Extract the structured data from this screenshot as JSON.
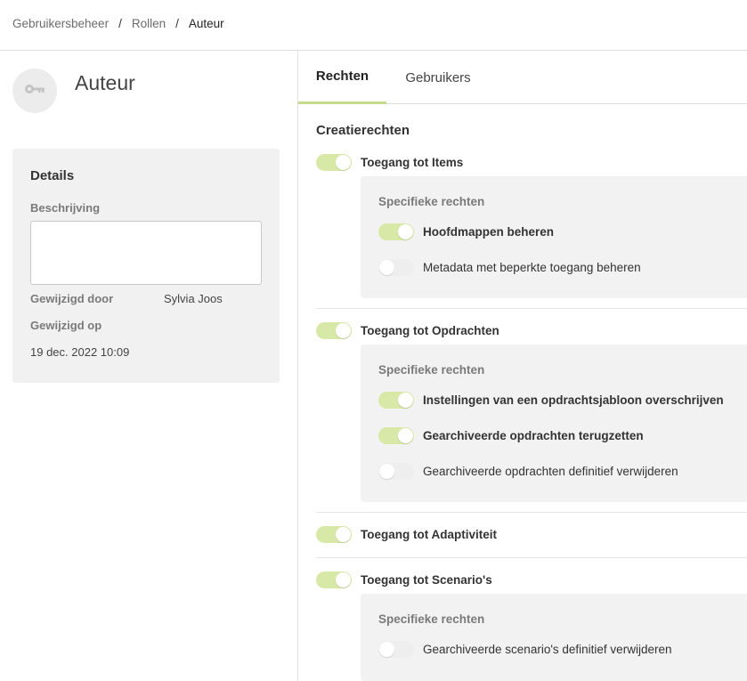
{
  "breadcrumb": {
    "items": [
      "Gebruikersbeheer",
      "Rollen"
    ],
    "current": "Auteur",
    "separator": "/"
  },
  "role": {
    "title": "Auteur",
    "icon": "key-icon"
  },
  "details": {
    "title": "Details",
    "description_label": "Beschrijving",
    "description_value": "",
    "modified_by_label": "Gewijzigd door",
    "modified_by_value": "Sylvia Joos",
    "modified_on_label": "Gewijzigd op",
    "modified_on_value": "19 dec. 2022 10:09"
  },
  "tabs": [
    {
      "label": "Rechten",
      "active": true
    },
    {
      "label": "Gebruikers",
      "active": false
    }
  ],
  "rights": {
    "section_title": "Creatierechten",
    "specific_title": "Specifieke rechten",
    "groups": [
      {
        "label": "Toegang tot Items",
        "enabled": true,
        "specific": [
          {
            "label": "Hoofdmappen beheren",
            "enabled": true
          },
          {
            "label": "Metadata met beperkte toegang beheren",
            "enabled": false
          }
        ]
      },
      {
        "label": "Toegang tot Opdrachten",
        "enabled": true,
        "specific": [
          {
            "label": "Instellingen van een opdrachtsjabloon overschrijven",
            "enabled": true
          },
          {
            "label": "Gearchiveerde opdrachten terugzetten",
            "enabled": true
          },
          {
            "label": "Gearchiveerde opdrachten definitief verwijderen",
            "enabled": false
          }
        ]
      },
      {
        "label": "Toegang tot Adaptiviteit",
        "enabled": true,
        "specific": []
      },
      {
        "label": "Toegang tot Scenario's",
        "enabled": true,
        "specific": [
          {
            "label": "Gearchiveerde scenario's definitief verwijderen",
            "enabled": false
          }
        ]
      }
    ]
  },
  "colors": {
    "toggle_on": "#d8e8a6",
    "toggle_off": "#eeeeee",
    "tab_accent": "#c5dc8a",
    "panel_bg": "#f1f2f1"
  }
}
